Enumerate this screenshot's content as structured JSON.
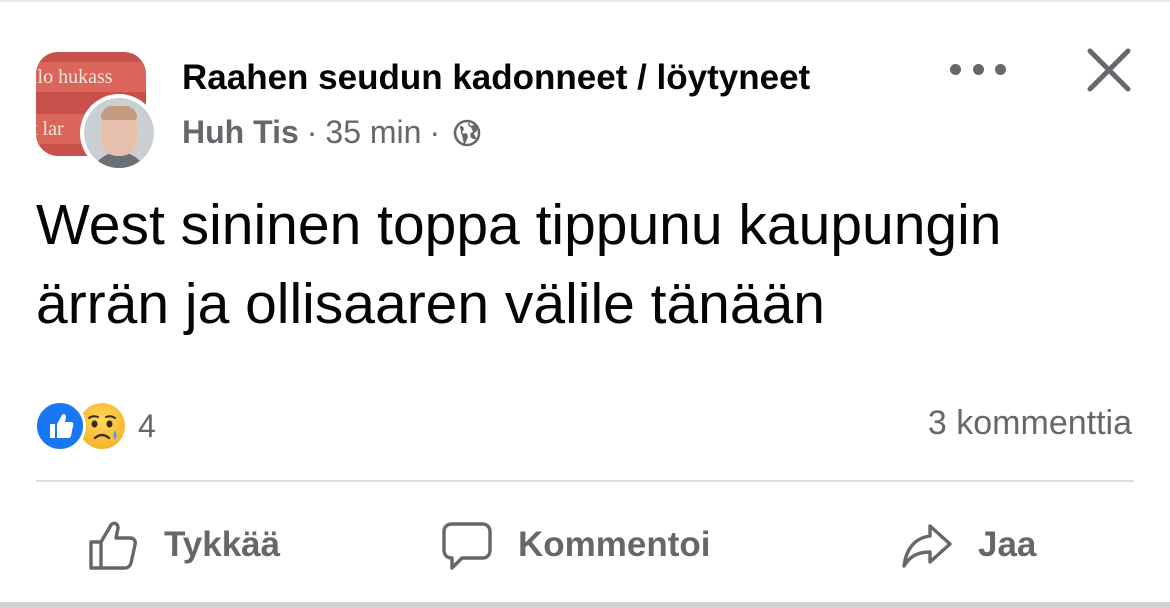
{
  "header": {
    "group_name": "Raahen seudun kadonneet / löytyneet",
    "group_avatar_lines": [
      "llo hukass",
      "t lar"
    ],
    "author": "Huh Tis",
    "separator": "·",
    "time": "35 min",
    "audience_icon": "globe-icon",
    "more_icon": "ellipsis-icon",
    "close_icon": "close-icon"
  },
  "post": {
    "text": "West sininen toppa tippunu kaupungin ärrän ja ollisaaren välile tänään"
  },
  "reactions": {
    "icons": [
      "like-icon",
      "sad-icon"
    ],
    "count": "4",
    "comments": "3 kommenttia"
  },
  "actions": {
    "like_label": "Tykkää",
    "comment_label": "Kommentoi",
    "share_label": "Jaa"
  },
  "colors": {
    "like_blue": "#1877f2",
    "secondary_text": "#65676b",
    "primary_text": "#050505",
    "divider": "#dadde1"
  }
}
